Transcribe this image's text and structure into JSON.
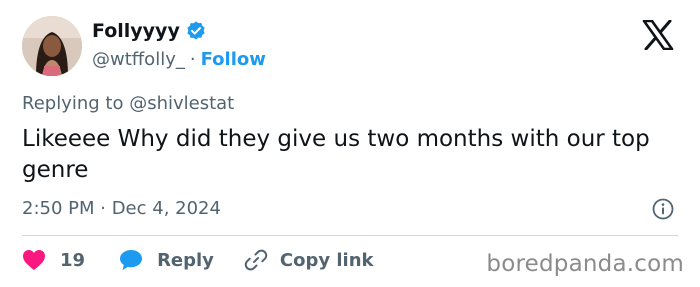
{
  "author": {
    "display_name": "Follyyyy",
    "handle": "@wtffolly_",
    "separator": "·",
    "follow_label": "Follow"
  },
  "tweet": {
    "replying_to": "Replying to @shivlestat",
    "text": "Likeeee Why did they give us two months with our top genre",
    "timestamp": "2:50 PM · Dec 4, 2024"
  },
  "actions": {
    "like_count": "19",
    "reply_label": "Reply",
    "copy_link_label": "Copy link"
  },
  "watermark": "boredpanda.com",
  "colors": {
    "accent": "#1d9bf0",
    "like": "#f91880",
    "text_primary": "#0f1419",
    "text_secondary": "#536471"
  },
  "icons": {
    "verified": "verified-badge-icon",
    "platform": "x-logo-icon",
    "info": "info-icon",
    "like": "heart-icon",
    "reply": "speech-bubble-icon",
    "copy_link": "link-icon"
  }
}
